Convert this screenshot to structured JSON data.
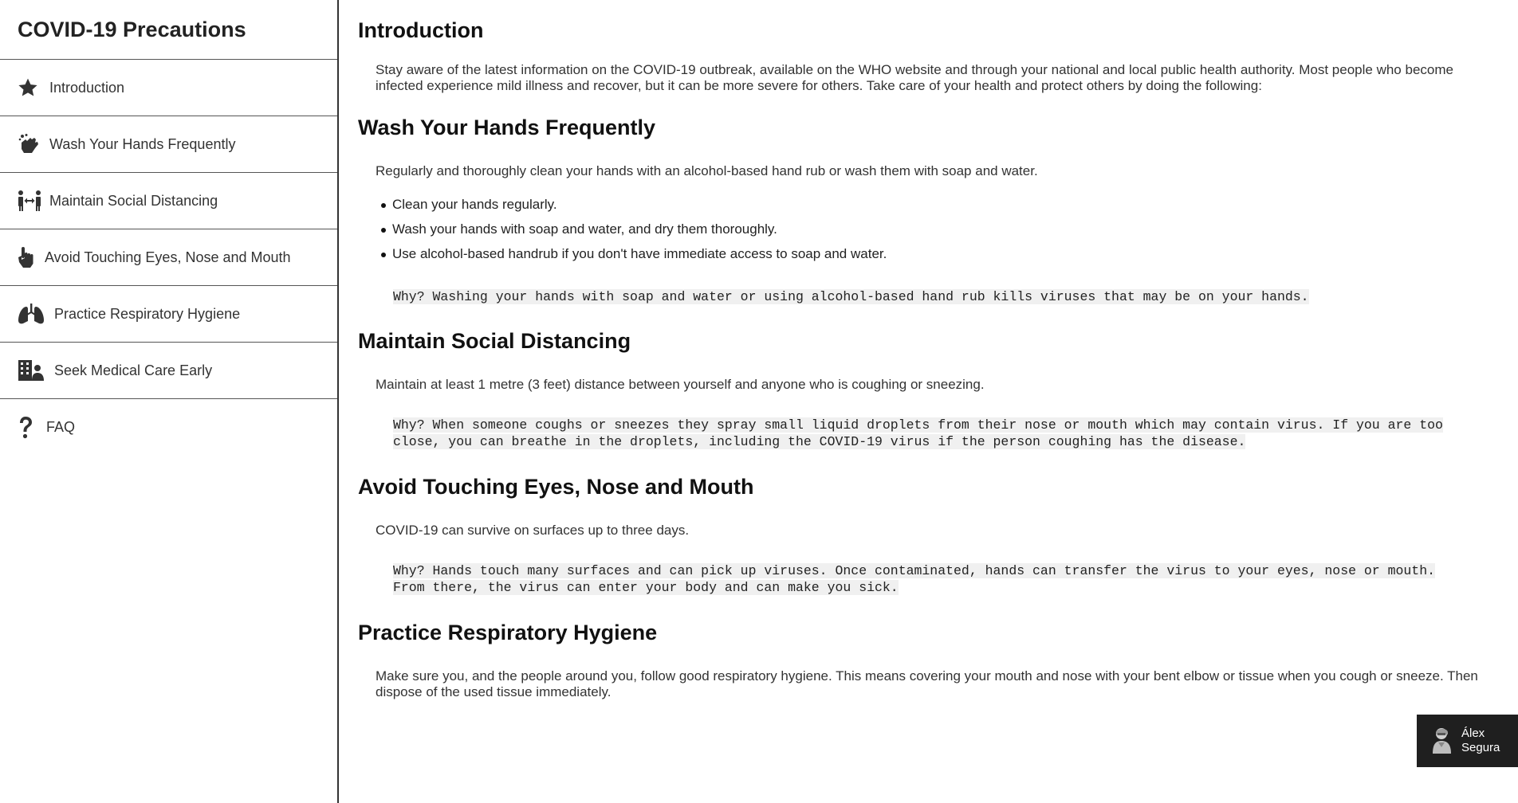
{
  "sidebar": {
    "title": "COVID-19 Precautions",
    "items": [
      {
        "label": "Introduction",
        "icon": "star-icon"
      },
      {
        "label": "Wash Your Hands Frequently",
        "icon": "hands-wash-icon"
      },
      {
        "label": "Maintain Social Distancing",
        "icon": "people-arrows-icon"
      },
      {
        "label": "Avoid Touching Eyes, Nose and Mouth",
        "icon": "hand-pointer-icon"
      },
      {
        "label": "Practice Respiratory Hygiene",
        "icon": "lungs-icon"
      },
      {
        "label": "Seek Medical Care Early",
        "icon": "clinic-medical-icon"
      },
      {
        "label": "FAQ",
        "icon": "question-icon"
      }
    ]
  },
  "main": {
    "intro": {
      "heading": "Introduction",
      "text": "Stay aware of the latest information on the COVID-19 outbreak, available on the WHO website and through your national and local public health authority. Most people who become infected experience mild illness and recover, but it can be more severe for others. Take care of your health and protect others by doing the following:"
    },
    "wash": {
      "heading": "Wash Your Hands Frequently",
      "text": "Regularly and thoroughly clean your hands with an alcohol-based hand rub or wash them with soap and water.",
      "bullets": [
        "Clean your hands regularly.",
        "Wash your hands with soap and water, and dry them thoroughly.",
        "Use alcohol-based handrub if you don't have immediate access to soap and water."
      ],
      "why": "Why? Washing your hands with soap and water or using alcohol-based hand rub kills viruses that may be on your hands."
    },
    "distancing": {
      "heading": "Maintain Social Distancing",
      "text": "Maintain at least 1 metre (3 feet) distance between yourself and anyone who is coughing or sneezing.",
      "why": "Why? When someone coughs or sneezes they spray small liquid droplets from their nose or mouth which may contain virus. If you are too close, you can breathe in the droplets, including the COVID-19 virus if the person coughing has the disease."
    },
    "touching": {
      "heading": "Avoid Touching Eyes, Nose and Mouth",
      "text": "COVID-19 can survive on surfaces up to three days.",
      "why": "Why? Hands touch many surfaces and can pick up viruses. Once contaminated, hands can transfer the virus to your eyes, nose or mouth. From there, the virus can enter your body and can make you sick."
    },
    "respiratory": {
      "heading": "Practice Respiratory Hygiene",
      "text": "Make sure you, and the people around you, follow good respiratory hygiene. This means covering your mouth and nose with your bent elbow or tissue when you cough or sneeze. Then dispose of the used tissue immediately."
    }
  },
  "badge": {
    "first": "Álex",
    "last": "Segura",
    "avatar_icon": "avatar-icon"
  },
  "colors": {
    "sidebar_border": "#333333",
    "code_bg": "#f0f0f0",
    "badge_bg": "#1f1f1f"
  }
}
